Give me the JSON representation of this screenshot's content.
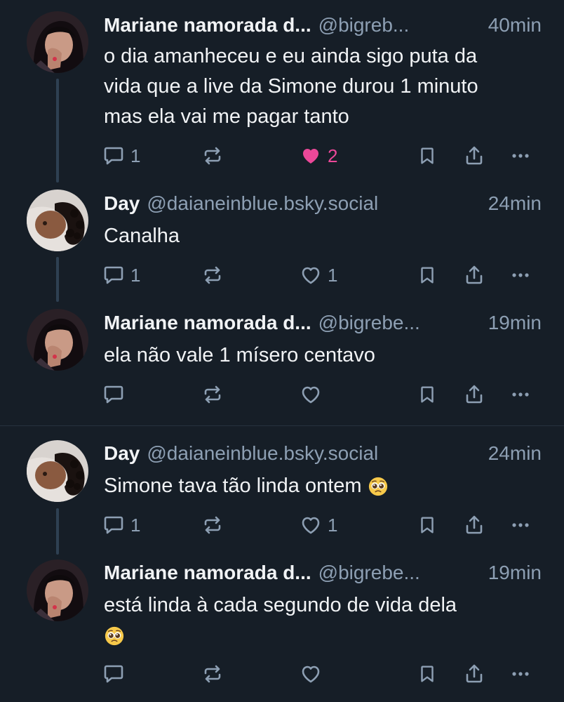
{
  "posts": [
    {
      "author_name": "Mariane namorada d...",
      "handle": "@bigreb...",
      "time": "40min",
      "text_lines": [
        "o dia amanheceu e eu ainda sigo puta da",
        "vida que a live da Simone durou 1 minuto",
        "mas ela vai me pagar tanto"
      ],
      "reply_count": "1",
      "repost_count": "",
      "like_count": "2",
      "liked": true
    },
    {
      "author_name": "Day",
      "handle": "@daianeinblue.bsky.social",
      "time": "24min",
      "text_lines": [
        "Canalha"
      ],
      "reply_count": "1",
      "repost_count": "",
      "like_count": "1",
      "liked": false
    },
    {
      "author_name": "Mariane namorada d...",
      "handle": "@bigrebe...",
      "time": "19min",
      "text_lines": [
        "ela não vale 1 mísero centavo"
      ],
      "reply_count": "",
      "repost_count": "",
      "like_count": "",
      "liked": false
    },
    {
      "author_name": "Day",
      "handle": "@daianeinblue.bsky.social",
      "time": "24min",
      "text_lines": [
        "Simone tava tão linda ontem"
      ],
      "reply_count": "1",
      "repost_count": "",
      "like_count": "1",
      "liked": false,
      "trailing_emoji": "pleading-face"
    },
    {
      "author_name": "Mariane namorada d...",
      "handle": "@bigrebe...",
      "time": "19min",
      "text_lines": [
        "está linda à cada segundo de vida dela"
      ],
      "reply_count": "",
      "repost_count": "",
      "like_count": "",
      "liked": false,
      "trailing_emoji": "pleading-face"
    }
  ],
  "colors": {
    "background": "#161e27",
    "text": "#f1f3f5",
    "muted": "#8d9fb3",
    "like_active": "#ec4899",
    "thread_line": "#2e4052"
  },
  "icons": {
    "reply": "speech-bubble-icon",
    "repost": "repost-arrows-icon",
    "like": "heart-icon",
    "bookmark": "bookmark-icon",
    "share": "share-icon",
    "more": "more-dots-icon"
  }
}
